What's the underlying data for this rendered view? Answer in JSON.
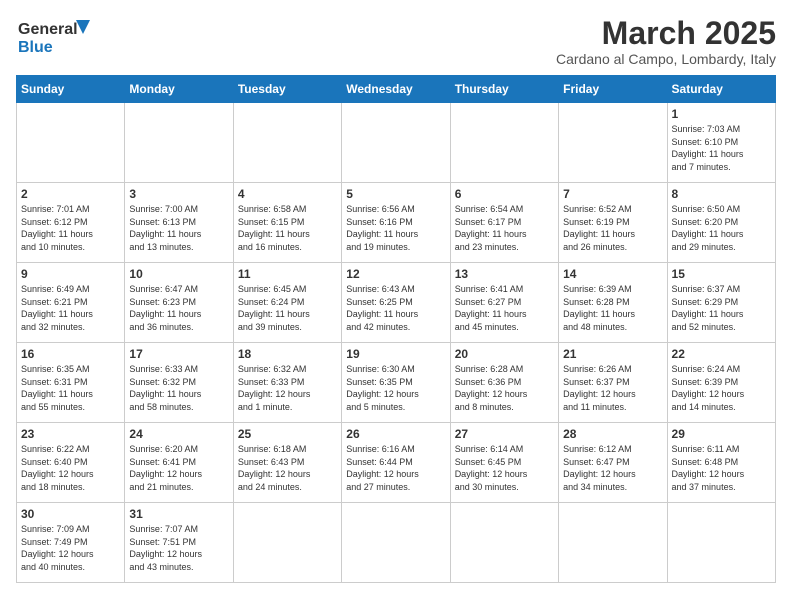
{
  "logo": {
    "line1": "General",
    "line2": "Blue"
  },
  "title": "March 2025",
  "subtitle": "Cardano al Campo, Lombardy, Italy",
  "weekdays": [
    "Sunday",
    "Monday",
    "Tuesday",
    "Wednesday",
    "Thursday",
    "Friday",
    "Saturday"
  ],
  "weeks": [
    [
      {
        "day": "",
        "info": ""
      },
      {
        "day": "",
        "info": ""
      },
      {
        "day": "",
        "info": ""
      },
      {
        "day": "",
        "info": ""
      },
      {
        "day": "",
        "info": ""
      },
      {
        "day": "",
        "info": ""
      },
      {
        "day": "1",
        "info": "Sunrise: 7:03 AM\nSunset: 6:10 PM\nDaylight: 11 hours\nand 7 minutes."
      }
    ],
    [
      {
        "day": "2",
        "info": "Sunrise: 7:01 AM\nSunset: 6:12 PM\nDaylight: 11 hours\nand 10 minutes."
      },
      {
        "day": "3",
        "info": "Sunrise: 7:00 AM\nSunset: 6:13 PM\nDaylight: 11 hours\nand 13 minutes."
      },
      {
        "day": "4",
        "info": "Sunrise: 6:58 AM\nSunset: 6:15 PM\nDaylight: 11 hours\nand 16 minutes."
      },
      {
        "day": "5",
        "info": "Sunrise: 6:56 AM\nSunset: 6:16 PM\nDaylight: 11 hours\nand 19 minutes."
      },
      {
        "day": "6",
        "info": "Sunrise: 6:54 AM\nSunset: 6:17 PM\nDaylight: 11 hours\nand 23 minutes."
      },
      {
        "day": "7",
        "info": "Sunrise: 6:52 AM\nSunset: 6:19 PM\nDaylight: 11 hours\nand 26 minutes."
      },
      {
        "day": "8",
        "info": "Sunrise: 6:50 AM\nSunset: 6:20 PM\nDaylight: 11 hours\nand 29 minutes."
      }
    ],
    [
      {
        "day": "9",
        "info": "Sunrise: 6:49 AM\nSunset: 6:21 PM\nDaylight: 11 hours\nand 32 minutes."
      },
      {
        "day": "10",
        "info": "Sunrise: 6:47 AM\nSunset: 6:23 PM\nDaylight: 11 hours\nand 36 minutes."
      },
      {
        "day": "11",
        "info": "Sunrise: 6:45 AM\nSunset: 6:24 PM\nDaylight: 11 hours\nand 39 minutes."
      },
      {
        "day": "12",
        "info": "Sunrise: 6:43 AM\nSunset: 6:25 PM\nDaylight: 11 hours\nand 42 minutes."
      },
      {
        "day": "13",
        "info": "Sunrise: 6:41 AM\nSunset: 6:27 PM\nDaylight: 11 hours\nand 45 minutes."
      },
      {
        "day": "14",
        "info": "Sunrise: 6:39 AM\nSunset: 6:28 PM\nDaylight: 11 hours\nand 48 minutes."
      },
      {
        "day": "15",
        "info": "Sunrise: 6:37 AM\nSunset: 6:29 PM\nDaylight: 11 hours\nand 52 minutes."
      }
    ],
    [
      {
        "day": "16",
        "info": "Sunrise: 6:35 AM\nSunset: 6:31 PM\nDaylight: 11 hours\nand 55 minutes."
      },
      {
        "day": "17",
        "info": "Sunrise: 6:33 AM\nSunset: 6:32 PM\nDaylight: 11 hours\nand 58 minutes."
      },
      {
        "day": "18",
        "info": "Sunrise: 6:32 AM\nSunset: 6:33 PM\nDaylight: 12 hours\nand 1 minute."
      },
      {
        "day": "19",
        "info": "Sunrise: 6:30 AM\nSunset: 6:35 PM\nDaylight: 12 hours\nand 5 minutes."
      },
      {
        "day": "20",
        "info": "Sunrise: 6:28 AM\nSunset: 6:36 PM\nDaylight: 12 hours\nand 8 minutes."
      },
      {
        "day": "21",
        "info": "Sunrise: 6:26 AM\nSunset: 6:37 PM\nDaylight: 12 hours\nand 11 minutes."
      },
      {
        "day": "22",
        "info": "Sunrise: 6:24 AM\nSunset: 6:39 PM\nDaylight: 12 hours\nand 14 minutes."
      }
    ],
    [
      {
        "day": "23",
        "info": "Sunrise: 6:22 AM\nSunset: 6:40 PM\nDaylight: 12 hours\nand 18 minutes."
      },
      {
        "day": "24",
        "info": "Sunrise: 6:20 AM\nSunset: 6:41 PM\nDaylight: 12 hours\nand 21 minutes."
      },
      {
        "day": "25",
        "info": "Sunrise: 6:18 AM\nSunset: 6:43 PM\nDaylight: 12 hours\nand 24 minutes."
      },
      {
        "day": "26",
        "info": "Sunrise: 6:16 AM\nSunset: 6:44 PM\nDaylight: 12 hours\nand 27 minutes."
      },
      {
        "day": "27",
        "info": "Sunrise: 6:14 AM\nSunset: 6:45 PM\nDaylight: 12 hours\nand 30 minutes."
      },
      {
        "day": "28",
        "info": "Sunrise: 6:12 AM\nSunset: 6:47 PM\nDaylight: 12 hours\nand 34 minutes."
      },
      {
        "day": "29",
        "info": "Sunrise: 6:11 AM\nSunset: 6:48 PM\nDaylight: 12 hours\nand 37 minutes."
      }
    ],
    [
      {
        "day": "30",
        "info": "Sunrise: 7:09 AM\nSunset: 7:49 PM\nDaylight: 12 hours\nand 40 minutes."
      },
      {
        "day": "31",
        "info": "Sunrise: 7:07 AM\nSunset: 7:51 PM\nDaylight: 12 hours\nand 43 minutes."
      },
      {
        "day": "",
        "info": ""
      },
      {
        "day": "",
        "info": ""
      },
      {
        "day": "",
        "info": ""
      },
      {
        "day": "",
        "info": ""
      },
      {
        "day": "",
        "info": ""
      }
    ]
  ]
}
